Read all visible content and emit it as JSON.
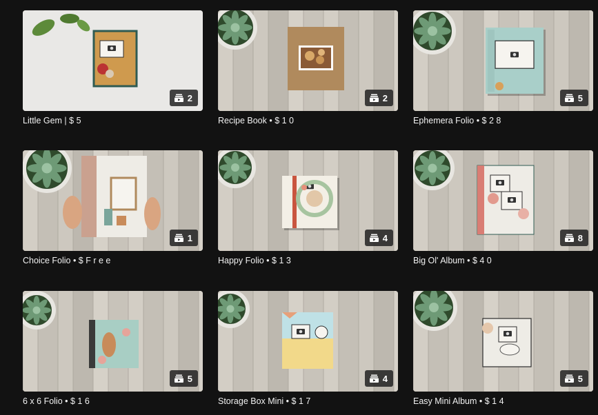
{
  "colors": {
    "background": "#121212",
    "title_text": "#f1f1f1",
    "badge_bg": "#1c1c1c"
  },
  "badge_icon": "playlist-icon",
  "items": [
    {
      "title": "Little Gem | $ 5",
      "count": "2",
      "scene": "gem"
    },
    {
      "title": "Recipe Book • $ 1 0",
      "count": "2",
      "scene": "recipe"
    },
    {
      "title": "Ephemera Folio • $ 2 8",
      "count": "5",
      "scene": "ephemera"
    },
    {
      "title": "Choice Folio • $ F r e e",
      "count": "1",
      "scene": "choice"
    },
    {
      "title": "Happy Folio • $ 1 3",
      "count": "4",
      "scene": "happy"
    },
    {
      "title": "Big Ol' Album • $ 4 0",
      "count": "8",
      "scene": "bigol"
    },
    {
      "title": "6 x 6 Folio • $ 1 6",
      "count": "5",
      "scene": "sixfolio"
    },
    {
      "title": "Storage Box Mini • $ 1 7",
      "count": "4",
      "scene": "storage"
    },
    {
      "title": "Easy Mini Album • $ 1 4",
      "count": "5",
      "scene": "easymini"
    }
  ]
}
